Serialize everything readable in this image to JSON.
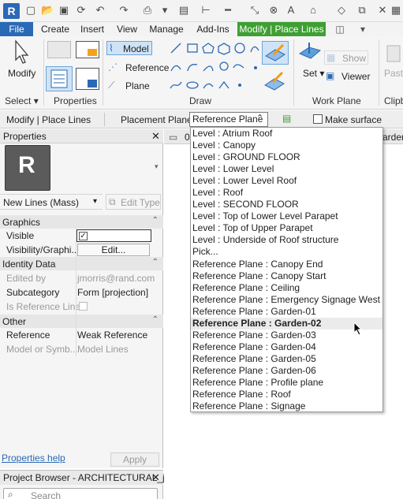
{
  "app": {
    "logo_letter": "R"
  },
  "tabs": [
    "File",
    "Create",
    "Insert",
    "View",
    "Manage",
    "Add-Ins",
    "Modify | Place Lines"
  ],
  "ribbon": {
    "modify_label": "Modify",
    "select_label": "Select",
    "properties_label": "Properties",
    "draw_label": "Draw",
    "model_label": "Model",
    "reference_label": "Reference",
    "plane_label": "Plane",
    "set_label": "Set",
    "show_label": "Show",
    "viewer_label": "Viewer",
    "workplane_label": "Work Plane",
    "paste_label": "Paste",
    "clipboard_label": "Clipb"
  },
  "options_bar": {
    "context": "Modify | Place Lines",
    "placement_plane_label": "Placement Plane:",
    "placement_plane_value": "Reference Plane",
    "surface_checkbox_label": "Make surface from c"
  },
  "properties": {
    "title": "Properties",
    "type_selector": "New Lines (Mass)",
    "edit_type": "Edit Type",
    "groups": {
      "graphics": "Graphics",
      "identity": "Identity Data",
      "other": "Other"
    },
    "rows": {
      "visible": "Visible",
      "visibility_graphics": "Visibility/Graphi...",
      "visibility_edit": "Edit...",
      "edited_by": "Edited by",
      "edited_by_value": "jmorris@rand.com",
      "subcategory": "Subcategory",
      "subcategory_value": "Form [projection]",
      "is_reference_line": "Is Reference Line",
      "reference": "Reference",
      "reference_value": "Weak Reference",
      "model_or_symbolic": "Model or Symb...",
      "model_or_symbolic_value": "Model Lines"
    },
    "help_link": "Properties help",
    "apply_button": "Apply"
  },
  "project_browser": {
    "title": "Project Browser - ARCHITECTURAL_j...",
    "search_placeholder": "Search"
  },
  "view_tabs": [
    "0",
    "arden"
  ],
  "dropdown_items": [
    "Level : Atrium Roof",
    "Level : Canopy",
    "Level : GROUND FLOOR",
    "Level : Lower Level",
    "Level : Lower Level Roof",
    "Level : Roof",
    "Level : SECOND FLOOR",
    "Level : Top of Lower Level Parapet",
    "Level : Top of Upper Parapet",
    "Level : Underside of Roof structure",
    "Pick...",
    "Reference Plane : Canopy End",
    "Reference Plane : Canopy Start",
    "Reference Plane : Ceiling",
    "Reference Plane : Emergency Signage West",
    "Reference Plane : Garden-01",
    "Reference Plane : Garden-02",
    "Reference Plane : Garden-03",
    "Reference Plane : Garden-04",
    "Reference Plane : Garden-05",
    "Reference Plane : Garden-06",
    "Reference Plane : Profile plane",
    "Reference Plane : Roof",
    "Reference Plane : Signage"
  ],
  "selected_item": "Reference Plane : Garden-02",
  "colors": {
    "accent_blue": "#2a69b6",
    "context_green": "#3e9f32"
  }
}
